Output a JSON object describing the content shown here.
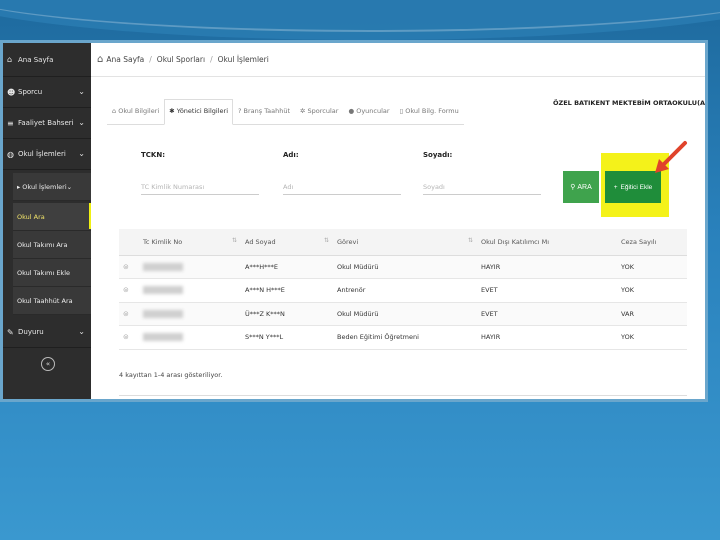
{
  "sidebar": {
    "items": [
      {
        "label": "Ana Sayfa",
        "icon": "home-icon"
      },
      {
        "label": "Sporcu",
        "icon": "users-icon"
      },
      {
        "label": "Faaliyet Bahseri",
        "icon": "list-icon"
      },
      {
        "label": "Okul İşlemleri",
        "icon": "globe-icon"
      },
      {
        "label": "Duyuru",
        "icon": "edit-icon"
      }
    ],
    "sub_header": "Okul İşlemleri",
    "sub_items": [
      {
        "label": "Okul Ara"
      },
      {
        "label": "Okul Takımı Ara"
      },
      {
        "label": "Okul Takımı Ekle"
      },
      {
        "label": "Okul Taahhüt Ara"
      }
    ],
    "collapse_glyph": "«"
  },
  "breadcrumb": [
    "Ana Sayfa",
    "Okul Sporları",
    "Okul İşlemleri"
  ],
  "tabs": [
    "Okul Bilgileri",
    "Yönetici Bilgileri",
    "Branş Taahhüt",
    "Sporcular",
    "Oyuncular",
    "Okul Bilg. Formu"
  ],
  "school_name": "ÖZEL BATIKENT MEKTEBİM ORTAOKULU(A)",
  "form": {
    "tckn_label": "TCKN:",
    "tckn_placeholder": "TC Kimlik Numarası",
    "ad_label": "Adı:",
    "ad_placeholder": "Adı",
    "soyad_label": "Soyadı:",
    "soyad_placeholder": "Soyadı",
    "search_button": "ARA",
    "add_button": "Eğitici Ekle"
  },
  "table": {
    "headers": [
      "Tc Kimlik No",
      "Ad Soyad",
      "Görevi",
      "Okul Dışı Katılımcı Mı",
      "Ceza Sayılı"
    ],
    "rows": [
      {
        "name": "A***H***E",
        "role": "Okul Müdürü",
        "external": "HAYIR",
        "penalty": "YOK"
      },
      {
        "name": "A***N H***E",
        "role": "Antrenör",
        "external": "EVET",
        "penalty": "YOK"
      },
      {
        "name": "Ü***Z K***N",
        "role": "Okul Müdürü",
        "external": "EVET",
        "penalty": "VAR"
      },
      {
        "name": "S***N Y***L",
        "role": "Beden Eğitimi Öğretmeni",
        "external": "HAYIR",
        "penalty": "YOK"
      }
    ]
  },
  "footer_text": "4 kayıttan 1-4 arası gösteriliyor.",
  "colors": {
    "sidebar": "#2d2d2d",
    "search_button": "#3fa34d",
    "add_button": "#1f8d3a",
    "highlight": "#f4f21a",
    "arrow": "#e0432b"
  }
}
